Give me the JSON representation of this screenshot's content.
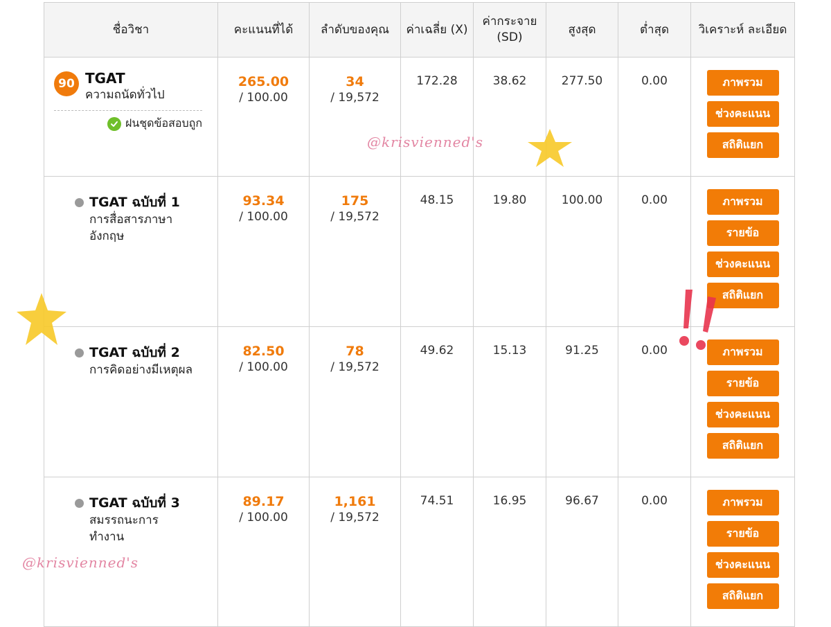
{
  "header": {
    "subject": "ชื่อวิชา",
    "score": "คะแนนที่ได้",
    "rank": "ลำดับของคุณ",
    "mean": "ค่าเฉลี่ย (X)",
    "sd": "ค่ากระจาย (SD)",
    "max": "สูงสุด",
    "min": "ต่ำสุด",
    "analysis": "วิเคราะห์ ละเอียด"
  },
  "main": {
    "badge": "90",
    "code": "TGAT",
    "name": "ความถนัดทั่วไป",
    "practice_label": "ฝนชุดข้อสอบถูก",
    "score": "265.00",
    "score_total": "/ 100.00",
    "rank": "34",
    "rank_total": "/ 19,572",
    "mean": "172.28",
    "sd": "38.62",
    "max": "277.50",
    "min": "0.00",
    "buttons": [
      "ภาพรวม",
      "ช่วงคะแนน",
      "สถิติแยก"
    ]
  },
  "subs": [
    {
      "code": "TGAT ฉบับที่ 1",
      "name": "การสื่อสารภาษาอังกฤษ",
      "score": "93.34",
      "score_total": "/ 100.00",
      "rank": "175",
      "rank_total": "/ 19,572",
      "mean": "48.15",
      "sd": "19.80",
      "max": "100.00",
      "min": "0.00",
      "buttons": [
        "ภาพรวม",
        "รายข้อ",
        "ช่วงคะแนน",
        "สถิติแยก"
      ]
    },
    {
      "code": "TGAT ฉบับที่ 2",
      "name": "การคิดอย่างมีเหตุผล",
      "score": "82.50",
      "score_total": "/ 100.00",
      "rank": "78",
      "rank_total": "/ 19,572",
      "mean": "49.62",
      "sd": "15.13",
      "max": "91.25",
      "min": "0.00",
      "buttons": [
        "ภาพรวม",
        "รายข้อ",
        "ช่วงคะแนน",
        "สถิติแยก"
      ]
    },
    {
      "code": "TGAT ฉบับที่ 3",
      "name": "สมรรถนะการทำงาน",
      "score": "89.17",
      "score_total": "/ 100.00",
      "rank": "1,161",
      "rank_total": "/ 19,572",
      "mean": "74.51",
      "sd": "16.95",
      "max": "96.67",
      "min": "0.00",
      "buttons": [
        "ภาพรวม",
        "รายข้อ",
        "ช่วงคะแนน",
        "สถิติแยก"
      ]
    }
  ],
  "watermark": "@krisvienned's",
  "colors": {
    "accent": "#f27c07",
    "score_text": "#f07b0c",
    "check": "#6fbf2a",
    "sticker_star": "#f7c928",
    "sticker_exclaim": "#e8344e"
  }
}
